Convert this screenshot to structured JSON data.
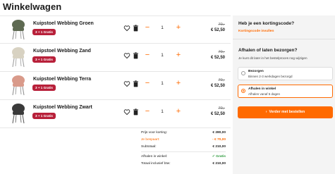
{
  "page": {
    "title": "Winkelwagen"
  },
  "cart": {
    "items": [
      {
        "name": "Kuipstoel Webbing Groen",
        "badge": "3 + 1 Gratis",
        "qty": "1",
        "old_price": "70,-",
        "new_price": "€ 52,50",
        "color": "#5e6a52"
      },
      {
        "name": "Kuipstoel Webbing Zand",
        "badge": "3 + 1 Gratis",
        "qty": "1",
        "old_price": "70,-",
        "new_price": "€ 52,50",
        "color": "#d8d2c2"
      },
      {
        "name": "Kuipstoel Webbing Terra",
        "badge": "3 + 1 Gratis",
        "qty": "1",
        "old_price": "70,-",
        "new_price": "€ 52,50",
        "color": "#d99a8a"
      },
      {
        "name": "Kuipstoel Webbing Zwart",
        "badge": "3 + 1 Gratis",
        "qty": "1",
        "old_price": "70,-",
        "new_price": "€ 52,50",
        "color": "#3a3a3a"
      }
    ],
    "minus_label": "−",
    "plus_label": "+"
  },
  "summary": {
    "before_discount_label": "Prijs voor korting:",
    "before_discount_value": "€ 280,00",
    "savings_label": "Je bespaart:",
    "savings_value": "- € 70,00",
    "subtotal_label": "Subtotaal:",
    "subtotal_value": "€ 210,00",
    "pickup_label": "Afhalen in winkel:",
    "pickup_value": "✓ Gratis",
    "total_label": "Totaal inclusief btw:",
    "total_value": "€ 210,00"
  },
  "sidebar": {
    "promo_title": "Heb je een kortingscode?",
    "promo_link": "Kortingscode invullen",
    "delivery_title": "Afhalen of laten bezorgen?",
    "delivery_sub": "Je kunt dit later in het bestelproces nog wijzigen",
    "options": [
      {
        "title": "Bezorgen",
        "sub": "Binnen 2-3 werkdagen bezorgd",
        "selected": false
      },
      {
        "title": "Afhalen in winkel",
        "sub": "Afhalen vanaf 5 dagen",
        "selected": true
      }
    ],
    "cta_label": "Verder met bestellen"
  },
  "colors": {
    "accent": "#ff6a00",
    "badge": "#b8203a",
    "sidebar_bg": "#f4f4f4",
    "green": "#2a9a3a"
  },
  "icons": [
    "heart-icon",
    "trash-icon",
    "chair-image",
    "chevron-right-icon",
    "radio-icon"
  ]
}
